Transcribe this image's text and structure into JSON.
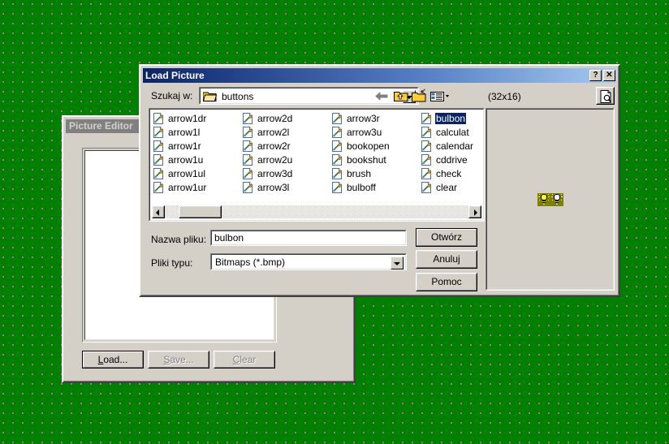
{
  "desktop": {
    "background_color": "#008000",
    "dot_color": "#e060c0"
  },
  "picture_editor": {
    "title": "Picture Editor",
    "buttons": [
      {
        "label": "Load...",
        "accel": "L",
        "state": "enabled"
      },
      {
        "label": "Save...",
        "accel": "S",
        "state": "disabled"
      },
      {
        "label": "Clear",
        "accel": "C",
        "state": "disabled"
      }
    ]
  },
  "dialog": {
    "title": "Load Picture",
    "titlebar_buttons": [
      {
        "name": "help",
        "glyph": "?"
      },
      {
        "name": "close",
        "glyph": "✕"
      }
    ],
    "lookin": {
      "label": "Szukaj w:",
      "value": "buttons",
      "icon": "folder-icon"
    },
    "toolbar": [
      {
        "name": "back-icon",
        "tooltip": ""
      },
      {
        "name": "up-one-level-icon",
        "tooltip": ""
      },
      {
        "name": "new-folder-icon",
        "tooltip": ""
      },
      {
        "name": "views-icon",
        "tooltip": ""
      }
    ],
    "dimensions_label": "(32x16)",
    "preview_button_icon": "preview-document-icon",
    "files": [
      {
        "name": "arrow1dr",
        "selected": false
      },
      {
        "name": "arrow1l",
        "selected": false
      },
      {
        "name": "arrow1r",
        "selected": false
      },
      {
        "name": "arrow1u",
        "selected": false
      },
      {
        "name": "arrow1ul",
        "selected": false
      },
      {
        "name": "arrow1ur",
        "selected": false
      },
      {
        "name": "arrow2d",
        "selected": false
      },
      {
        "name": "arrow2l",
        "selected": false
      },
      {
        "name": "arrow2r",
        "selected": false
      },
      {
        "name": "arrow2u",
        "selected": false
      },
      {
        "name": "arrow3d",
        "selected": false
      },
      {
        "name": "arrow3l",
        "selected": false
      },
      {
        "name": "arrow3r",
        "selected": false
      },
      {
        "name": "arrow3u",
        "selected": false
      },
      {
        "name": "bookopen",
        "selected": false
      },
      {
        "name": "bookshut",
        "selected": false
      },
      {
        "name": "brush",
        "selected": false
      },
      {
        "name": "bulboff",
        "selected": false
      },
      {
        "name": "bulbon",
        "selected": true
      },
      {
        "name": "calculat",
        "selected": false
      },
      {
        "name": "calendar",
        "selected": false
      },
      {
        "name": "cddrive",
        "selected": false
      },
      {
        "name": "check",
        "selected": false
      },
      {
        "name": "clear",
        "selected": false
      }
    ],
    "filename": {
      "label": "Nazwa pliku:",
      "value": "bulbon",
      "placeholder": ""
    },
    "filetype": {
      "label": "Pliki typu:",
      "value": "Bitmaps (*.bmp)"
    },
    "buttons": [
      {
        "label": "Otwórz",
        "default": true
      },
      {
        "label": "Anuluj",
        "default": false
      },
      {
        "label": "Pomoc",
        "default": false
      }
    ],
    "colors": {
      "titlebar_active_start": "#0a246a",
      "titlebar_active_end": "#a6caf0",
      "titlebar_inactive": "#808080",
      "face": "#d4d0c8",
      "selection": "#0a246a"
    }
  }
}
